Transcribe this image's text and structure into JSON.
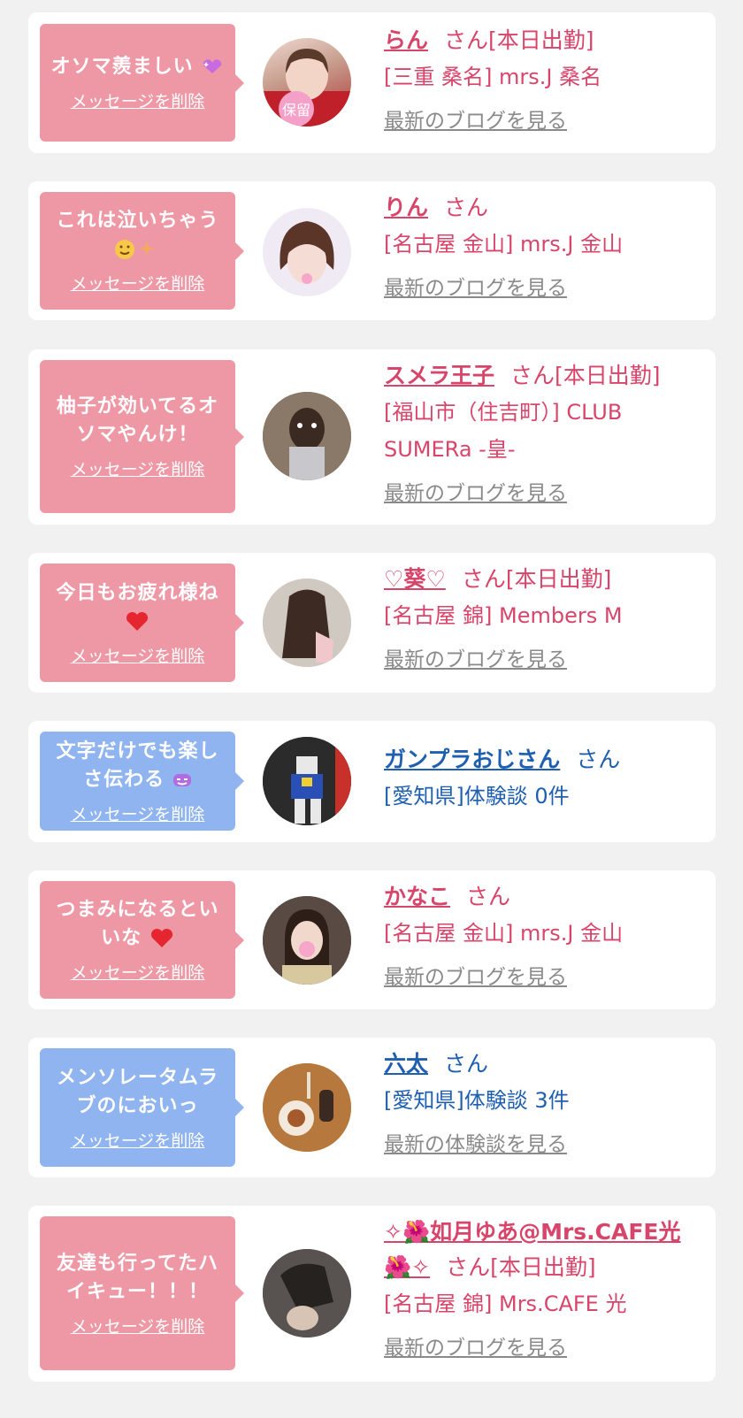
{
  "colors": {
    "pink_bubble": "#ef98a5",
    "blue_bubble": "#8fb4ef",
    "pink_text": "#d8456a",
    "blue_text": "#1f5fb0",
    "link_gray": "#8a8a8a"
  },
  "cards": [
    {
      "message": "オソマ羨ましい",
      "message_icon": "sparkle-heart-icon",
      "delete_label": "メッセージを削除",
      "name": "らん",
      "san": "さん[本日出勤]",
      "shop": "[三重 桑名] mrs.J 桑名",
      "link": "最新のブログを見る",
      "avatar_badge": "保留"
    },
    {
      "message": "これは泣いちゃう",
      "message_icon": "teary-smile-icon",
      "delete_label": "メッセージを削除",
      "name": "りん",
      "san": "さん",
      "shop": "[名古屋 金山] mrs.J 金山",
      "link": "最新のブログを見る"
    },
    {
      "message": "柚子が効いてるオソマやんけ！",
      "delete_label": "メッセージを削除",
      "name": "スメラ王子",
      "san": "さん[本日出勤]",
      "shop": "[福山市（住吉町）] CLUB SUMERa -皇-",
      "link": "最新のブログを見る"
    },
    {
      "message": "今日もお疲れ様ね",
      "message_icon": "red-heart-icon",
      "delete_label": "メッセージを削除",
      "name": "♡葵♡",
      "san": "さん[本日出勤]",
      "shop": "[名古屋 錦] Members M",
      "link": "最新のブログを見る"
    },
    {
      "message": "文字だけでも楽しさ伝わる",
      "message_icon": "purple-face-icon",
      "delete_label": "メッセージを削除",
      "name": "ガンプラおじさん",
      "san": "さん",
      "shop": "[愛知県]体験談 0件"
    },
    {
      "message": "つまみになるといいな",
      "message_icon": "bye-heart-icon",
      "delete_label": "メッセージを削除",
      "name": "かなこ",
      "san": "さん",
      "shop": "[名古屋 金山] mrs.J 金山",
      "link": "最新のブログを見る"
    },
    {
      "message": "メンソレータムラブのにおいっ",
      "delete_label": "メッセージを削除",
      "name": "六太",
      "san": "さん",
      "shop": "[愛知県]体験談 3件",
      "link": "最新の体験談を見る"
    },
    {
      "message": "友達も行ってたハイキュー！！！",
      "delete_label": "メッセージを削除",
      "name": "✧🌺如月ゆあ@Mrs.CAFE光🌺✧",
      "san": "さん[本日出勤]",
      "shop": "[名古屋 錦] Mrs.CAFE 光",
      "link": "最新のブログを見る"
    }
  ]
}
